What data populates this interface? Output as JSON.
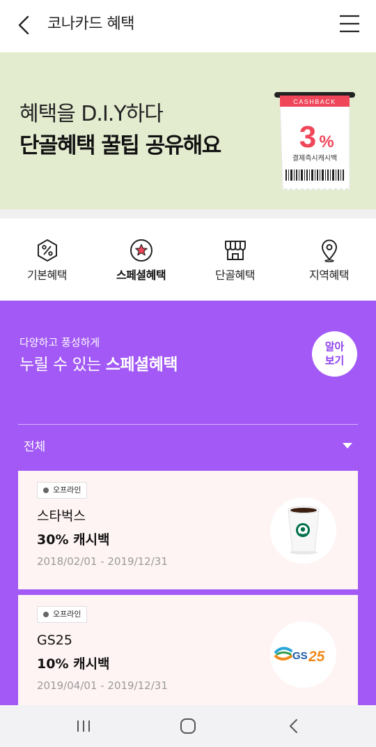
{
  "header": {
    "title": "코나카드 혜택",
    "back_icon": "chevron-left-icon",
    "menu_icon": "hamburger-menu-icon"
  },
  "banner": {
    "subtitle": "혜택을 D.I.Y하다",
    "title": "단골혜택 꿀팁 공유해요",
    "background": "#e4ecd0",
    "ticket": {
      "tag": "CASHBACK",
      "value": "3",
      "unit": "%",
      "caption": "결제즉시캐시백",
      "accent": "#f0465a"
    }
  },
  "categories": [
    {
      "label": "기본혜택",
      "icon": "percent-hexagon-icon",
      "active": false
    },
    {
      "label": "스페셜혜택",
      "icon": "star-circle-icon",
      "active": true
    },
    {
      "label": "단골혜택",
      "icon": "storefront-icon",
      "active": false
    },
    {
      "label": "지역혜택",
      "icon": "location-pin-icon",
      "active": false
    }
  ],
  "special": {
    "background": "#a259f5",
    "subtitle": "다양하고 풍성하게",
    "title_plain": "누릴 수 있는 ",
    "title_bold": "스페셜혜택",
    "learn_more_line1": "알아",
    "learn_more_line2": "보기",
    "filter": {
      "selected": "전체"
    },
    "cards": [
      {
        "badge": "오프라인",
        "merchant": "스타벅스",
        "benefit": "30% 캐시백",
        "period": "2018/02/01 - 2019/12/31",
        "logo_icon": "starbucks-cup-icon"
      },
      {
        "badge": "오프라인",
        "merchant": "GS25",
        "benefit": "10% 캐시백",
        "period": "2019/04/01 - 2019/12/31",
        "logo_icon": "gs25-logo-icon",
        "logo_text": "GS25"
      }
    ]
  },
  "system_nav": {
    "recents_icon": "recent-apps-icon",
    "home_icon": "home-icon",
    "back_icon": "back-icon"
  }
}
